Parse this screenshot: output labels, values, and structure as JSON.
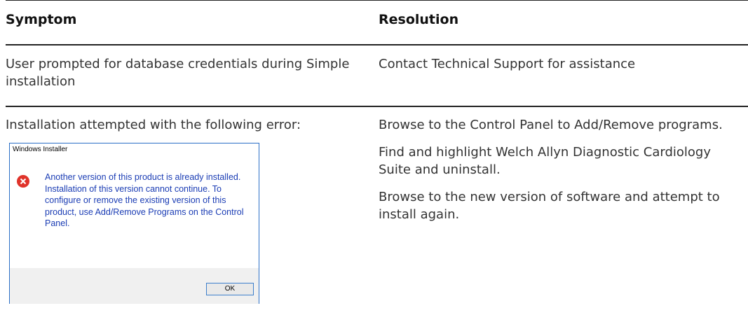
{
  "table": {
    "headers": {
      "symptom": "Symptom",
      "resolution": "Resolution"
    },
    "rows": [
      {
        "symptom": "User prompted for database credentials during Simple installation",
        "resolution": [
          "Contact Technical Support for assistance"
        ]
      },
      {
        "symptom": "Installation attempted with the following error:",
        "resolution": [
          "Browse to the Control Panel to Add/Remove programs.",
          "Find and highlight Welch Allyn Diagnostic Cardiology Suite and uninstall.",
          "Browse to the new version of software and attempt to install again."
        ]
      }
    ]
  },
  "dialog": {
    "title": "Windows Installer",
    "icon": "error-icon",
    "message": "Another version of this product is already installed.  Installation of this version cannot continue.  To configure or remove the existing version of this product, use Add/Remove Programs on the Control Panel.",
    "ok_label": "OK"
  },
  "colors": {
    "rule": "#222222",
    "dialog_border": "#2b6fc7",
    "dialog_text": "#1a3cb4",
    "error_icon": "#e0332a"
  }
}
